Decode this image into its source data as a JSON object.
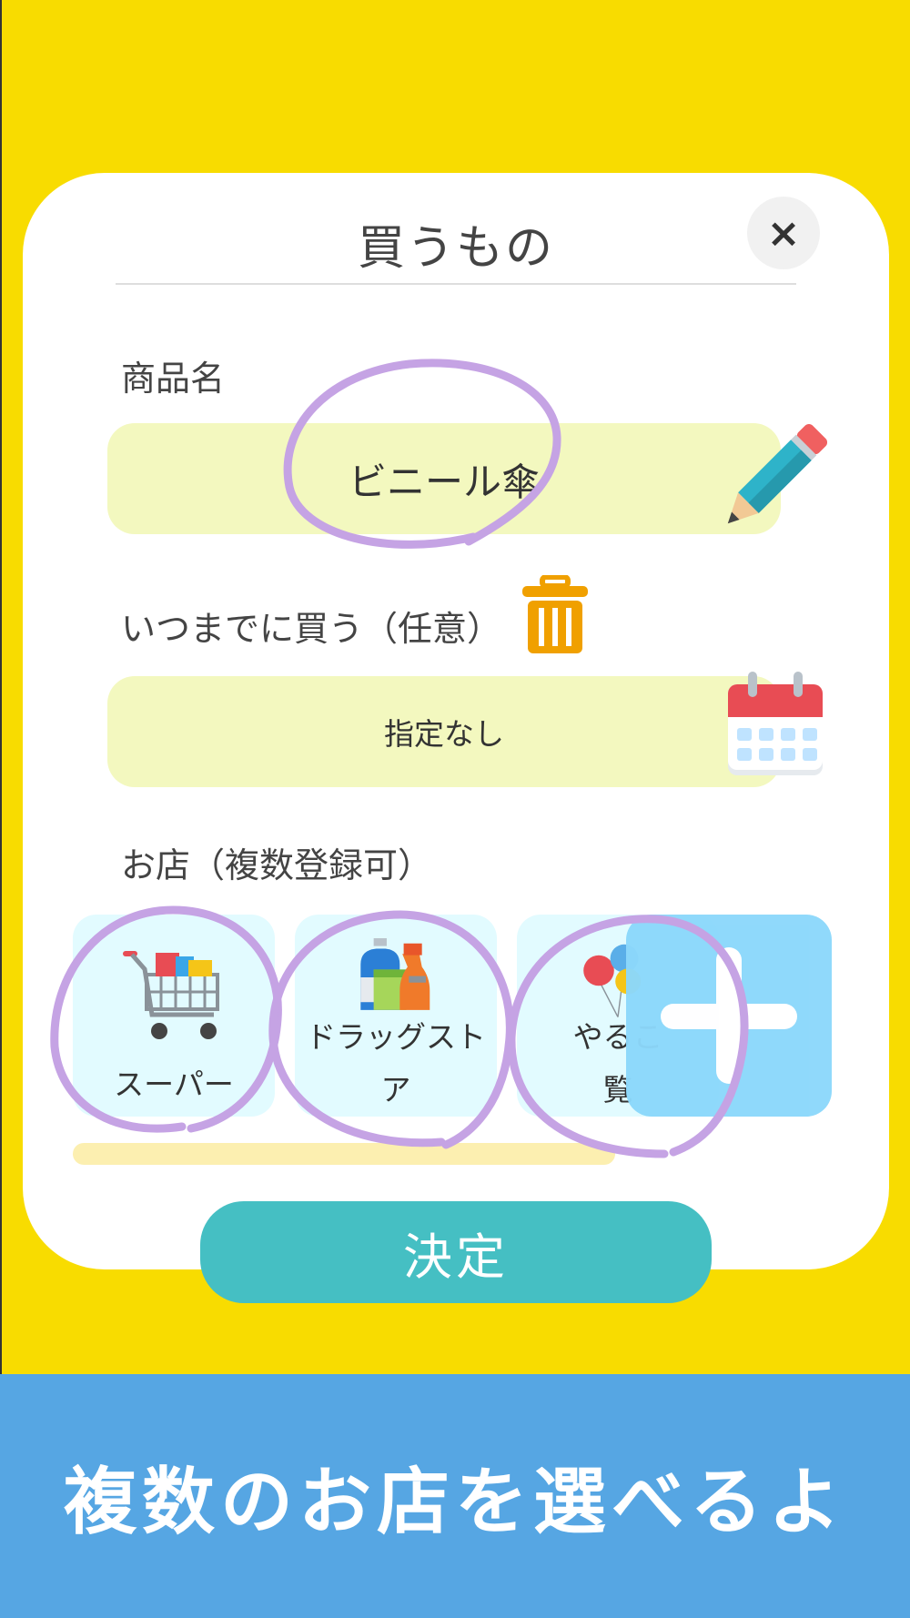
{
  "dialog": {
    "title": "買うもの",
    "close_label": "×",
    "product_label": "商品名",
    "product_value": "ビニール傘",
    "deadline_label": "いつまでに買う（任意）",
    "deadline_value": "指定なし",
    "shops_label": "お店（複数登録可）",
    "shops": [
      {
        "name": "スーパー",
        "icon": "shopping-cart-icon"
      },
      {
        "name": "ドラッグスト ア",
        "icon": "cleaning-products-icon"
      },
      {
        "name": "やるこ 覧",
        "icon": "balloons-icon"
      }
    ],
    "add_shop_icon": "plus-icon",
    "confirm_label": "決定"
  },
  "banner": {
    "text": "複数のお店を選べるよ"
  },
  "colors": {
    "background": "#f8dc00",
    "input_bg": "#f3f8bf",
    "shop_bg": "#e2fbff",
    "add_button": "#8cd8fb",
    "confirm": "#45bfc3",
    "banner": "#56a6e3",
    "annotation": "#c5a3e4"
  }
}
